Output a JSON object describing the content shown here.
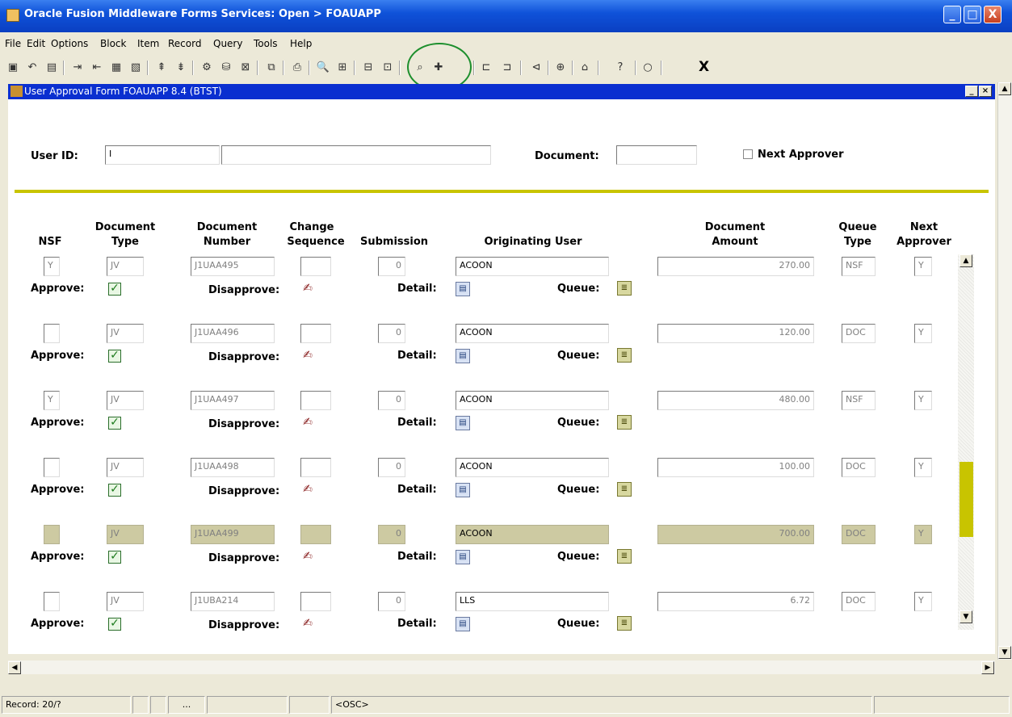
{
  "window": {
    "title": "Oracle Fusion Middleware Forms Services:  Open > FOAUAPP",
    "min": "_",
    "max": "□",
    "close": "X"
  },
  "menu": [
    "File",
    "Edit",
    "Options",
    "Block",
    "Item",
    "Record",
    "Query",
    "Tools",
    "Help"
  ],
  "toolbar": {
    "exit_label": "X"
  },
  "form": {
    "title": "User Approval Form  FOAUAPP  8.4  (BTST)",
    "user_id_label": "User ID:",
    "user_id_value": "I",
    "user_name_value": "",
    "document_label": "Document:",
    "document_value": "",
    "next_approver_label": "Next Approver"
  },
  "columns": {
    "nsf": "NSF",
    "doc_type": [
      "Document",
      "Type"
    ],
    "doc_number": [
      "Document",
      "Number"
    ],
    "change_seq": [
      "Change",
      "Sequence"
    ],
    "submission": "Submission",
    "orig_user": "Originating User",
    "doc_amount": [
      "Document",
      "Amount"
    ],
    "queue_type": [
      "Queue",
      "Type"
    ],
    "next_approver": [
      "Next",
      "Approver"
    ]
  },
  "row_labels": {
    "approve": "Approve:",
    "disapprove": "Disapprove:",
    "detail": "Detail:",
    "queue": "Queue:"
  },
  "rows": [
    {
      "nsf": "Y",
      "type": "JV",
      "number": "J1UAA495",
      "seq": "",
      "submission": "0",
      "user": "ACOON",
      "amount": "270.00",
      "queue_type": "NSF",
      "next": "Y"
    },
    {
      "nsf": "",
      "type": "JV",
      "number": "J1UAA496",
      "seq": "",
      "submission": "0",
      "user": "ACOON",
      "amount": "120.00",
      "queue_type": "DOC",
      "next": "Y"
    },
    {
      "nsf": "Y",
      "type": "JV",
      "number": "J1UAA497",
      "seq": "",
      "submission": "0",
      "user": "ACOON",
      "amount": "480.00",
      "queue_type": "NSF",
      "next": "Y"
    },
    {
      "nsf": "",
      "type": "JV",
      "number": "J1UAA498",
      "seq": "",
      "submission": "0",
      "user": "ACOON",
      "amount": "100.00",
      "queue_type": "DOC",
      "next": "Y"
    },
    {
      "nsf": "",
      "type": "JV",
      "number": "J1UAA499",
      "seq": "",
      "submission": "0",
      "user": "ACOON",
      "amount": "700.00",
      "queue_type": "DOC",
      "next": "Y"
    },
    {
      "nsf": "",
      "type": "JV",
      "number": "J1UBA214",
      "seq": "",
      "submission": "0",
      "user": "LLS",
      "amount": "6.72",
      "queue_type": "DOC",
      "next": "Y"
    }
  ],
  "selected_row": 4,
  "status": {
    "record": "Record: 20/?",
    "ellipsis": "...",
    "mode": "<OSC>"
  }
}
